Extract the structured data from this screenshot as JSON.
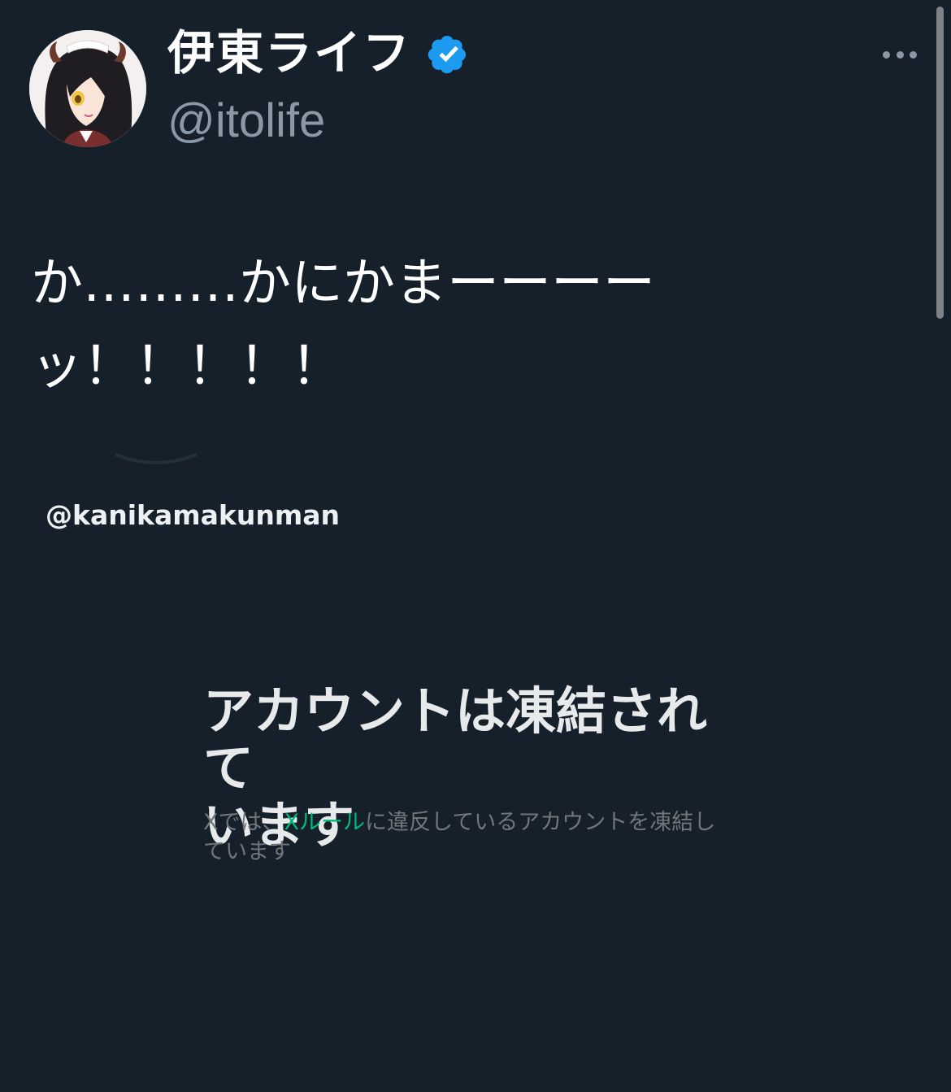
{
  "profile": {
    "display_name": "伊東ライフ",
    "handle": "@itolife",
    "verified_color": "#1d9bf0",
    "avatar_icon": "anime-girl-avatar"
  },
  "header": {
    "more_icon": "more-dots-icon"
  },
  "tweet": {
    "line1": "か………かにかまーーーー",
    "line2": "ッ！！！！！"
  },
  "embed": {
    "watermark": "@kanikamakunman",
    "title_line1": "アカウントは凍結されて",
    "title_line2": "います",
    "desc_prefix": "Xでは、",
    "desc_link": "Xルール",
    "desc_suffix": "に違反しているアカウントを凍結し",
    "desc_line2": "ています",
    "link_color": "#00ba7c"
  },
  "colors": {
    "background": "#15202b",
    "secondary_text": "#8b98a5"
  }
}
